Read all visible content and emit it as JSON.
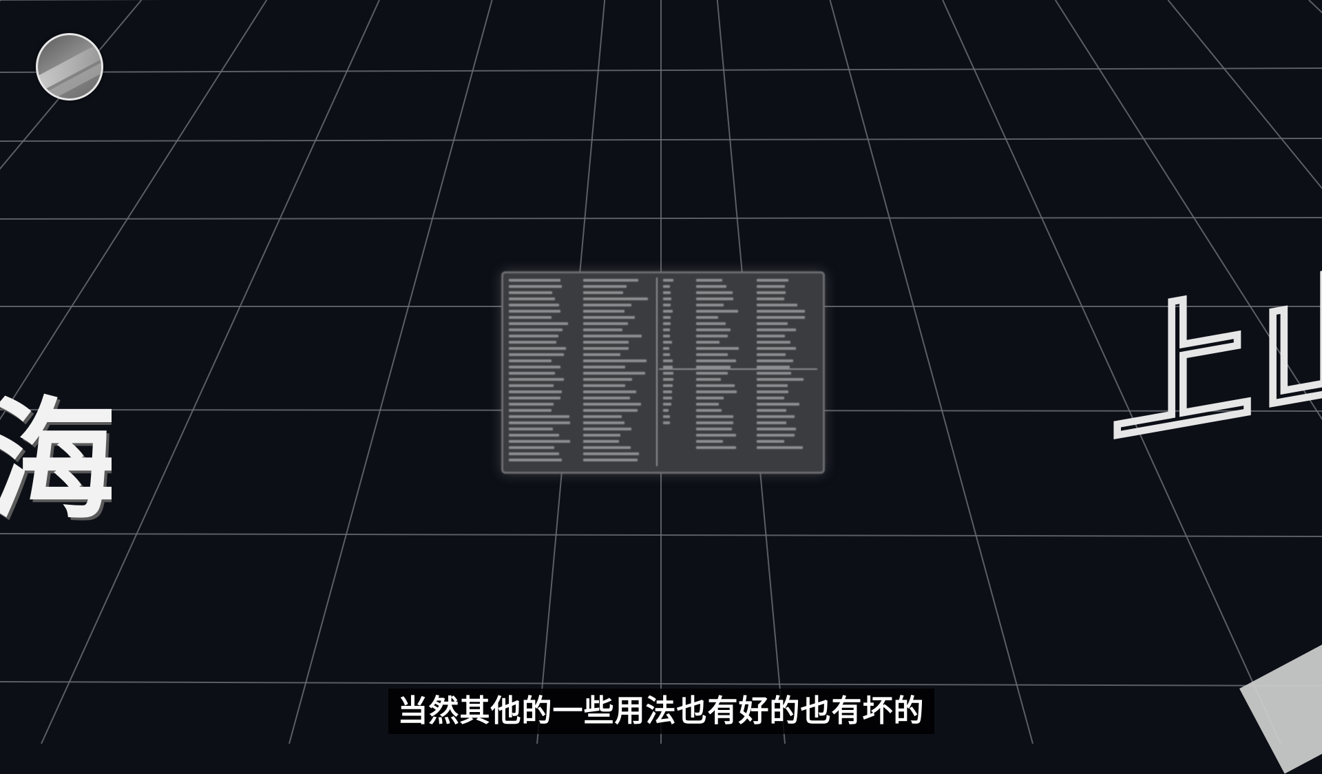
{
  "video_frame": {
    "top_title_outline": "",
    "left_large_char": "海",
    "right_outline_chars": "上山",
    "subtitle": "当然其他的一些用法也有好的也有坏的"
  },
  "icons": {
    "avatar": "channel-avatar-icon",
    "document": "blurred-document-icon"
  },
  "colors": {
    "background": "#0c0f16",
    "grid": "#6a6d73",
    "outline_text": "#e6e6e6",
    "subtitle_bg": "#000000",
    "subtitle_text": "#ffffff"
  }
}
